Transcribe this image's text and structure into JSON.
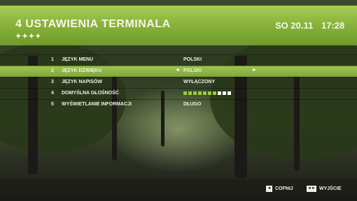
{
  "header": {
    "title": "4 USTAWIENIA TERMINALA",
    "dots": "✦✦✦✦",
    "date": "SO 20.11",
    "time": "17:28"
  },
  "menu": {
    "selected_index": 1,
    "items": [
      {
        "num": "1",
        "label": "JĘZYK MENU",
        "value": "POLSKI"
      },
      {
        "num": "2",
        "label": "JĘZYK DŹWIĘKU",
        "value": "POLSKI",
        "arrow_left": "◄",
        "arrow_right": "►"
      },
      {
        "num": "3",
        "label": "JĘZYK NAPISÓW",
        "value": "WYŁĄCZONY"
      },
      {
        "num": "4",
        "label": "DOMYŚLNA GŁOŚNOŚĆ",
        "volume": {
          "filled": 7,
          "total": 10,
          "colors": {
            "filled": "#9ccb3c",
            "empty": "#ffffff"
          }
        }
      },
      {
        "num": "5",
        "label": "WYŚWIETLANIE INFORMACJI",
        "value": "DŁUGO"
      }
    ]
  },
  "footer": {
    "back": {
      "key_icon": "back-key-icon",
      "label": "COFNIJ"
    },
    "exit": {
      "key_icon": "exit-key-icon",
      "label": "WYJŚCIE"
    }
  },
  "colors": {
    "accent": "#8ab43c",
    "text": "#f0f0e8"
  }
}
